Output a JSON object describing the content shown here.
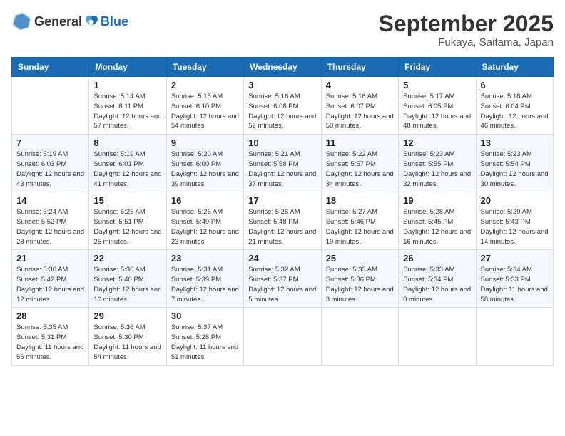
{
  "header": {
    "logo_general": "General",
    "logo_blue": "Blue",
    "month_year": "September 2025",
    "location": "Fukaya, Saitama, Japan"
  },
  "days_of_week": [
    "Sunday",
    "Monday",
    "Tuesday",
    "Wednesday",
    "Thursday",
    "Friday",
    "Saturday"
  ],
  "weeks": [
    [
      {
        "day": "",
        "info": ""
      },
      {
        "day": "1",
        "info": "Sunrise: 5:14 AM\nSunset: 6:11 PM\nDaylight: 12 hours\nand 57 minutes."
      },
      {
        "day": "2",
        "info": "Sunrise: 5:15 AM\nSunset: 6:10 PM\nDaylight: 12 hours\nand 54 minutes."
      },
      {
        "day": "3",
        "info": "Sunrise: 5:16 AM\nSunset: 6:08 PM\nDaylight: 12 hours\nand 52 minutes."
      },
      {
        "day": "4",
        "info": "Sunrise: 5:16 AM\nSunset: 6:07 PM\nDaylight: 12 hours\nand 50 minutes."
      },
      {
        "day": "5",
        "info": "Sunrise: 5:17 AM\nSunset: 6:05 PM\nDaylight: 12 hours\nand 48 minutes."
      },
      {
        "day": "6",
        "info": "Sunrise: 5:18 AM\nSunset: 6:04 PM\nDaylight: 12 hours\nand 46 minutes."
      }
    ],
    [
      {
        "day": "7",
        "info": "Sunrise: 5:19 AM\nSunset: 6:03 PM\nDaylight: 12 hours\nand 43 minutes."
      },
      {
        "day": "8",
        "info": "Sunrise: 5:19 AM\nSunset: 6:01 PM\nDaylight: 12 hours\nand 41 minutes."
      },
      {
        "day": "9",
        "info": "Sunrise: 5:20 AM\nSunset: 6:00 PM\nDaylight: 12 hours\nand 39 minutes."
      },
      {
        "day": "10",
        "info": "Sunrise: 5:21 AM\nSunset: 5:58 PM\nDaylight: 12 hours\nand 37 minutes."
      },
      {
        "day": "11",
        "info": "Sunrise: 5:22 AM\nSunset: 5:57 PM\nDaylight: 12 hours\nand 34 minutes."
      },
      {
        "day": "12",
        "info": "Sunrise: 5:23 AM\nSunset: 5:55 PM\nDaylight: 12 hours\nand 32 minutes."
      },
      {
        "day": "13",
        "info": "Sunrise: 5:23 AM\nSunset: 5:54 PM\nDaylight: 12 hours\nand 30 minutes."
      }
    ],
    [
      {
        "day": "14",
        "info": "Sunrise: 5:24 AM\nSunset: 5:52 PM\nDaylight: 12 hours\nand 28 minutes."
      },
      {
        "day": "15",
        "info": "Sunrise: 5:25 AM\nSunset: 5:51 PM\nDaylight: 12 hours\nand 25 minutes."
      },
      {
        "day": "16",
        "info": "Sunrise: 5:26 AM\nSunset: 5:49 PM\nDaylight: 12 hours\nand 23 minutes."
      },
      {
        "day": "17",
        "info": "Sunrise: 5:26 AM\nSunset: 5:48 PM\nDaylight: 12 hours\nand 21 minutes."
      },
      {
        "day": "18",
        "info": "Sunrise: 5:27 AM\nSunset: 5:46 PM\nDaylight: 12 hours\nand 19 minutes."
      },
      {
        "day": "19",
        "info": "Sunrise: 5:28 AM\nSunset: 5:45 PM\nDaylight: 12 hours\nand 16 minutes."
      },
      {
        "day": "20",
        "info": "Sunrise: 5:29 AM\nSunset: 5:43 PM\nDaylight: 12 hours\nand 14 minutes."
      }
    ],
    [
      {
        "day": "21",
        "info": "Sunrise: 5:30 AM\nSunset: 5:42 PM\nDaylight: 12 hours\nand 12 minutes."
      },
      {
        "day": "22",
        "info": "Sunrise: 5:30 AM\nSunset: 5:40 PM\nDaylight: 12 hours\nand 10 minutes."
      },
      {
        "day": "23",
        "info": "Sunrise: 5:31 AM\nSunset: 5:39 PM\nDaylight: 12 hours\nand 7 minutes."
      },
      {
        "day": "24",
        "info": "Sunrise: 5:32 AM\nSunset: 5:37 PM\nDaylight: 12 hours\nand 5 minutes."
      },
      {
        "day": "25",
        "info": "Sunrise: 5:33 AM\nSunset: 5:36 PM\nDaylight: 12 hours\nand 3 minutes."
      },
      {
        "day": "26",
        "info": "Sunrise: 5:33 AM\nSunset: 5:34 PM\nDaylight: 12 hours\nand 0 minutes."
      },
      {
        "day": "27",
        "info": "Sunrise: 5:34 AM\nSunset: 5:33 PM\nDaylight: 11 hours\nand 58 minutes."
      }
    ],
    [
      {
        "day": "28",
        "info": "Sunrise: 5:35 AM\nSunset: 5:31 PM\nDaylight: 11 hours\nand 56 minutes."
      },
      {
        "day": "29",
        "info": "Sunrise: 5:36 AM\nSunset: 5:30 PM\nDaylight: 11 hours\nand 54 minutes."
      },
      {
        "day": "30",
        "info": "Sunrise: 5:37 AM\nSunset: 5:28 PM\nDaylight: 11 hours\nand 51 minutes."
      },
      {
        "day": "",
        "info": ""
      },
      {
        "day": "",
        "info": ""
      },
      {
        "day": "",
        "info": ""
      },
      {
        "day": "",
        "info": ""
      }
    ]
  ]
}
